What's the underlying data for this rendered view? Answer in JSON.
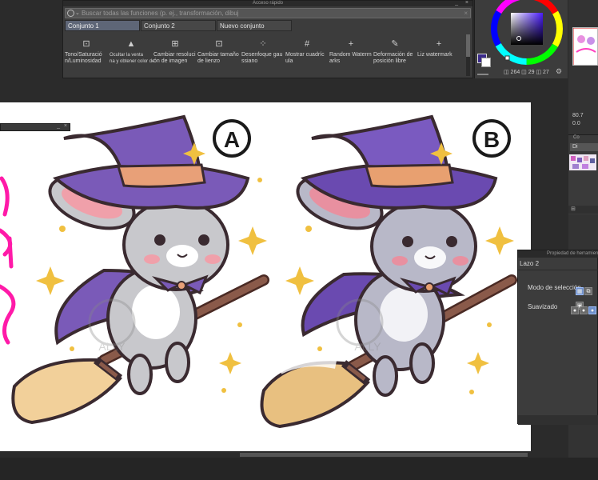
{
  "quick_access": {
    "title": "Acceso rápido",
    "minimize": "_",
    "close": "×",
    "search_placeholder": "Buscar todas las funciones (p. ej., transformación, dibuj",
    "tabs": [
      "Conjunto 1",
      "Conjunto 2",
      "Nuevo conjunto"
    ],
    "commands": [
      {
        "icon": "⊡",
        "label": "Tono/Saturació\nn/Luminosidad"
      },
      {
        "icon": "▲",
        "label": "Ocultar la venta\nna y obtener color de"
      },
      {
        "icon": "⊞",
        "label": "Cambiar resoluci\nón de imagen"
      },
      {
        "icon": "⊡",
        "label": "Cambiar tamaño\nde lienzo"
      },
      {
        "icon": "⁘",
        "label": "Desenfoque gau\nssiano"
      },
      {
        "icon": "#",
        "label": "Mostrar cuadríc\nula"
      },
      {
        "icon": "+",
        "label": "Random Waterm\narks"
      },
      {
        "icon": "✎",
        "label": "Deformación de\nposición libre"
      },
      {
        "icon": "+",
        "label": "Liz watermark"
      }
    ]
  },
  "color_panel": {
    "values": "◫ 264 ◫ 29 ◫ 27",
    "foreground_color": "#3a2a8a",
    "background_color": "#ffffff"
  },
  "navigator": {
    "zoom": "80.7",
    "rotation": "0.0"
  },
  "layer_panel": {
    "tab": "Co",
    "row": "Di"
  },
  "left_float": {
    "minimize": "_",
    "close": "×"
  },
  "tool_property": {
    "title": "Propiedad de herramienta",
    "tool_name": "Lazo 2",
    "selection_mode_label": "Modo de selección",
    "smoothing_label": "Suavizado"
  },
  "artwork": {
    "label_a": "A",
    "label_b": "B",
    "watermark": "ALLY"
  }
}
